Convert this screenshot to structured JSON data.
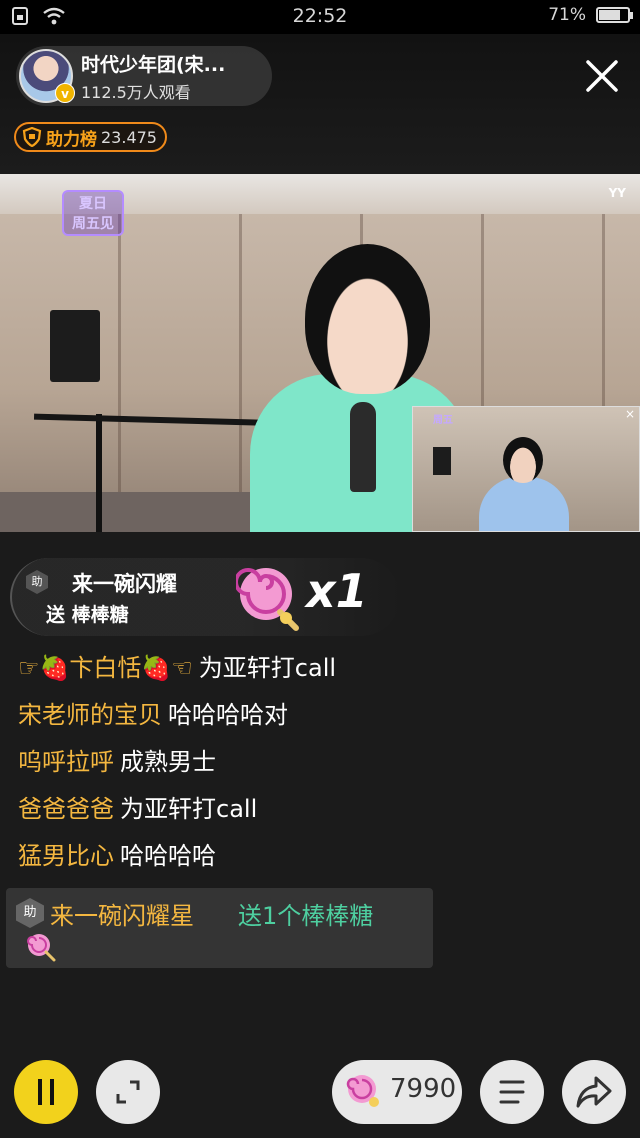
{
  "status_bar": {
    "time": "22:52",
    "battery": "71%",
    "battery_level": 0.71,
    "icons": [
      "sim-icon",
      "wifi-icon",
      "battery-icon"
    ]
  },
  "header": {
    "host_name": "时代少年团(宋...",
    "viewers": "112.5万人观看",
    "rank_label": "助力榜",
    "rank_value": "23.475"
  },
  "video": {
    "logo_text_1": "夏日",
    "logo_text_2": "周五见",
    "corner_mark": "YY"
  },
  "gift_banner": {
    "badge": "助",
    "sender": "来一碗闪耀",
    "send_text": "送 棒棒糖",
    "count": "x1"
  },
  "chat": [
    {
      "user": "☞🍓卞白恬🍓☜",
      "message": "为亚轩打call"
    },
    {
      "user": "宋老师的宝贝",
      "message": "哈哈哈哈对"
    },
    {
      "user": "呜呼拉呼",
      "message": "成熟男士"
    },
    {
      "user": "爸爸爸爸",
      "message": "为亚轩打call"
    },
    {
      "user": "猛男比心",
      "message": "哈哈哈哈"
    }
  ],
  "gift_message": {
    "badge": "助",
    "user": "来一碗闪耀星",
    "text": "送1个棒棒糖"
  },
  "bottom_bar": {
    "coins": "7990"
  },
  "colors": {
    "username": "#f4b740",
    "gift_text": "#4ecfa0",
    "pause_button": "#f2d21c",
    "rank_border": "#f08a1a"
  }
}
